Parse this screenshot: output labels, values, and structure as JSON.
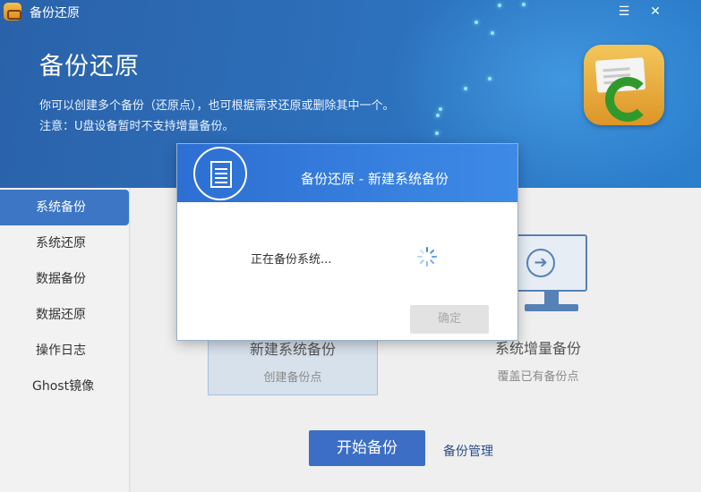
{
  "window": {
    "title": "备份还原",
    "minimize_label": "☰",
    "close_label": "✕"
  },
  "header": {
    "page_title": "备份还原",
    "desc_line1": "你可以创建多个备份（还原点），也可根据需求还原或删除其中一个。",
    "desc_line2": "注意：U盘设备暂时不支持增量备份。"
  },
  "sidebar": {
    "items": [
      {
        "label": "系统备份",
        "active": true
      },
      {
        "label": "系统还原",
        "active": false
      },
      {
        "label": "数据备份",
        "active": false
      },
      {
        "label": "数据还原",
        "active": false
      },
      {
        "label": "操作日志",
        "active": false
      },
      {
        "label": "Ghost镜像",
        "active": false
      }
    ]
  },
  "main": {
    "new_backup": {
      "title": "新建系统备份",
      "subtitle": "创建备份点"
    },
    "incremental_backup": {
      "title": "系统增量备份",
      "subtitle": "覆盖已有备份点"
    },
    "start_button": "开始备份",
    "manage_link": "备份管理"
  },
  "modal": {
    "title": "备份还原 - 新建系统备份",
    "status_text": "正在备份系统...",
    "ok_button": "确定",
    "ok_enabled": false
  },
  "colors": {
    "header_blue": "#2d6eb9",
    "accent_blue": "#3c76c4",
    "modal_header": "#2d6fd2"
  }
}
